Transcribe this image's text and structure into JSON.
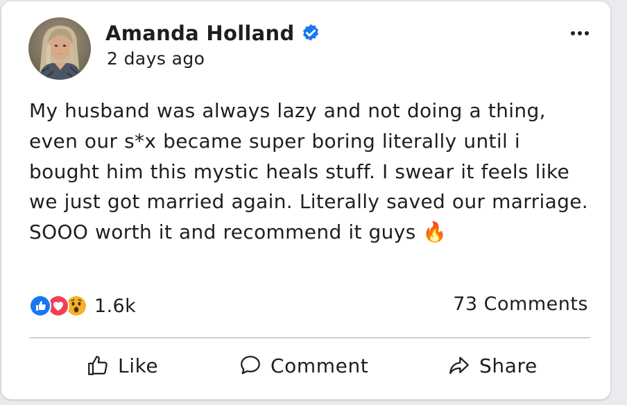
{
  "post": {
    "author": "Amanda Holland",
    "verified_icon": "verified-badge-icon",
    "timestamp": "2 days ago",
    "more_icon": "more-options-icon",
    "text": "My husband was always lazy and not doing a thing, even our s*x became super boring literally until i bought him this mystic heals stuff. I swear it feels like we just got married again. Literally saved our marriage. SOOO worth it and recommend it guys 🔥"
  },
  "reactions": {
    "icons": [
      "like-reaction-icon",
      "love-reaction-icon",
      "wow-reaction-icon"
    ],
    "count": "1.6k"
  },
  "comments": {
    "count_label": "73 Comments"
  },
  "actions": {
    "like_label": "Like",
    "like_icon": "thumbs-up-icon",
    "comment_label": "Comment",
    "comment_icon": "speech-bubble-icon",
    "share_label": "Share",
    "share_icon": "share-arrow-icon"
  },
  "colors": {
    "verified_blue": "#1877f2",
    "like_blue": "#1877f2",
    "love_red": "#f33e58",
    "wow_yellow": "#f7b125",
    "text": "#1c1e21",
    "divider": "#ced0d4"
  }
}
